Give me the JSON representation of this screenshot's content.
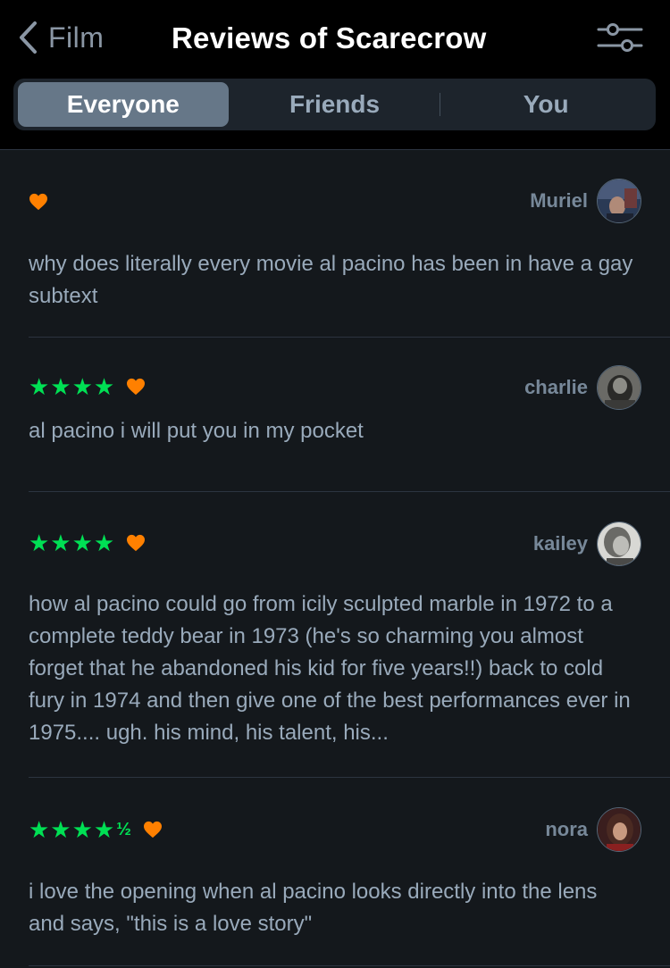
{
  "header": {
    "back_label": "Film",
    "title": "Reviews of Scarecrow"
  },
  "tabs": [
    {
      "label": "Everyone",
      "active": true
    },
    {
      "label": "Friends",
      "active": false
    },
    {
      "label": "You",
      "active": false
    }
  ],
  "colors": {
    "star": "#00e054",
    "heart": "#ff8000",
    "active_tab": "#667788",
    "background": "#14181c"
  },
  "reviews": [
    {
      "author": "Muriel",
      "stars": "",
      "liked": true,
      "text": "why does literally every movie al pacino has been in have a gay subtext"
    },
    {
      "author": "charlie",
      "stars": "★★★★",
      "liked": true,
      "text": "al pacino i will put you in my pocket"
    },
    {
      "author": "kailey",
      "stars": "★★★★",
      "liked": true,
      "text": "how al pacino could go from icily sculpted marble in 1972 to a complete teddy bear in 1973 (he's so charming you almost forget that he abandoned his kid for five years!!) back to cold fury in 1974 and then give one of the best performances ever in 1975.... ugh. his mind, his talent, his..."
    },
    {
      "author": "nora",
      "stars": "★★★★½",
      "liked": true,
      "text": "i love the opening when al pacino looks directly into the lens and says, \"this is a love story\""
    }
  ]
}
